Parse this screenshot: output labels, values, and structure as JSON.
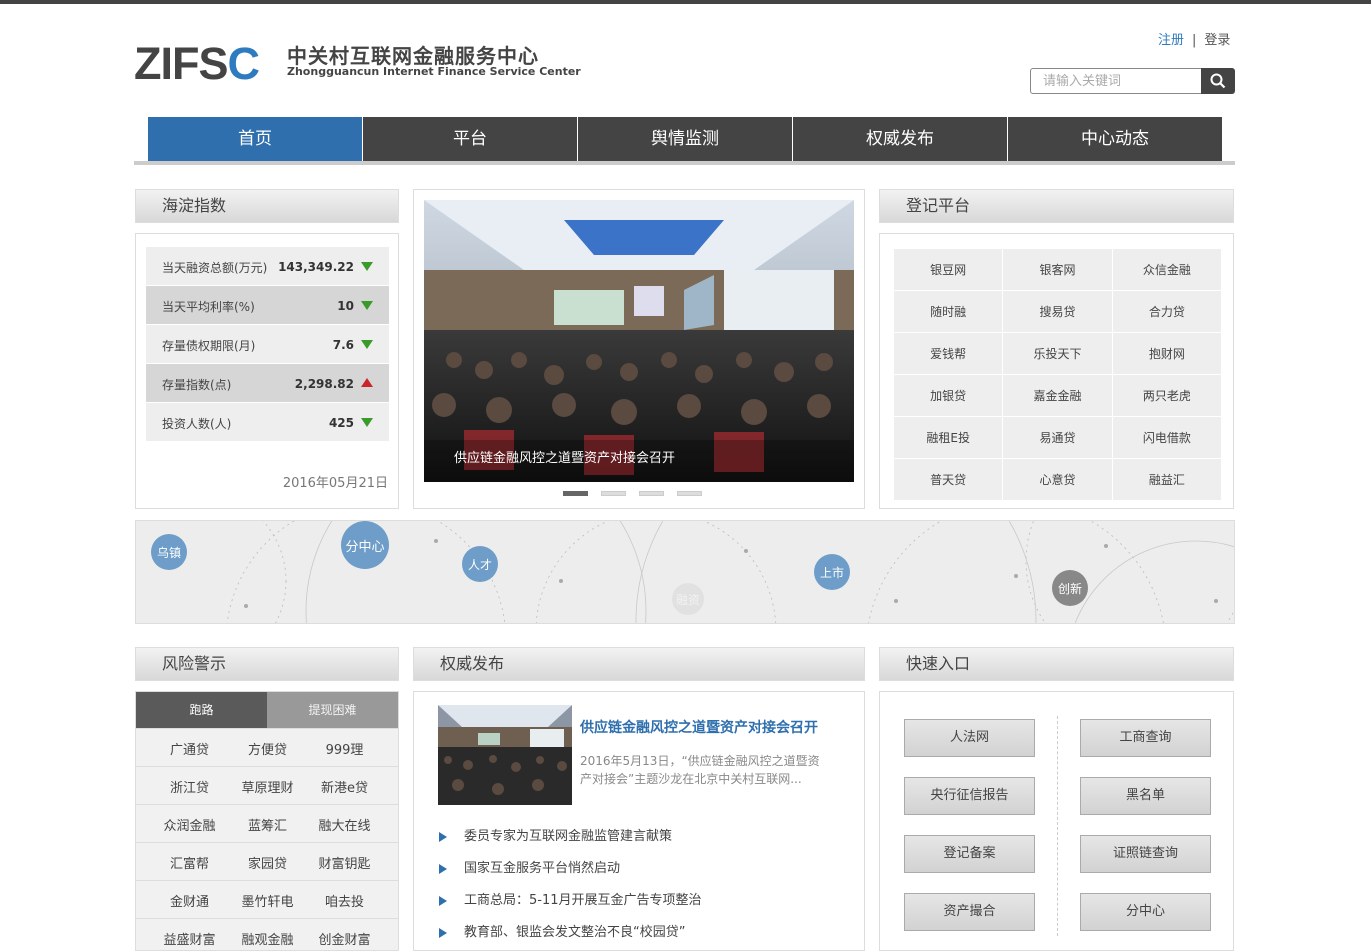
{
  "logo": {
    "mark": "ZIFS",
    "mark_c": "C",
    "name_cn": "中关村互联网金融服务中心",
    "name_en": "Zhongguancun Internet Finance Service Center"
  },
  "auth": {
    "register": "注册",
    "separator": "|",
    "login": "登录"
  },
  "search": {
    "placeholder": "请输入关键词",
    "icon": "search-icon"
  },
  "nav": {
    "items": [
      {
        "label": "首页",
        "active": true
      },
      {
        "label": "平台"
      },
      {
        "label": "舆情监测"
      },
      {
        "label": "权威发布"
      },
      {
        "label": "中心动态"
      }
    ]
  },
  "haidian": {
    "title": "海淀指数",
    "rows": [
      {
        "label": "当天融资总额(万元)",
        "value": "143,349.22",
        "trend": "down"
      },
      {
        "label": "当天平均利率(%)",
        "value": "10",
        "trend": "down"
      },
      {
        "label": "存量债权期限(月)",
        "value": "7.6",
        "trend": "down"
      },
      {
        "label": "存量指数(点)",
        "value": "2,298.82",
        "trend": "up"
      },
      {
        "label": "投资人数(人)",
        "value": "425",
        "trend": "down"
      }
    ],
    "date": "2016年05月21日"
  },
  "carousel": {
    "caption": "供应链金融风控之道暨资产对接会召开",
    "slide_count": 4,
    "active": 0
  },
  "registry": {
    "title": "登记平台",
    "items": [
      [
        "银豆网",
        "银客网",
        "众信金融"
      ],
      [
        "随时融",
        "搜易贷",
        "合力贷"
      ],
      [
        "爱钱帮",
        "乐投天下",
        "抱财网"
      ],
      [
        "加银贷",
        "嘉金金融",
        "两只老虎"
      ],
      [
        "融租E投",
        "易通贷",
        "闪电借款"
      ],
      [
        "普天贷",
        "心意贷",
        "融益汇"
      ]
    ]
  },
  "banner": {
    "bubbles": [
      "乌镇",
      "分中心",
      "人才",
      "上市",
      "创新",
      "融资"
    ]
  },
  "risk": {
    "title": "风险警示",
    "tabs": [
      "跑路",
      "提现困难"
    ],
    "rows": [
      [
        "广通贷",
        "方便贷",
        "999理"
      ],
      [
        "浙江贷",
        "草原理财",
        "新港e贷"
      ],
      [
        "众润金融",
        "蓝筹汇",
        "融大在线"
      ],
      [
        "汇富帮",
        "家园贷",
        "财富钥匙"
      ],
      [
        "金财通",
        "墨竹轩电",
        "咱去投"
      ],
      [
        "益盛财富",
        "融观金融",
        "创金财富"
      ]
    ]
  },
  "authority": {
    "title": "权威发布",
    "feature": {
      "title": "供应链金融风控之道暨资产对接会召开",
      "summary": "2016年5月13日，“供应链金融风控之道暨资产对接会”主题沙龙在北京中关村互联网..."
    },
    "list": [
      "委员专家为互联网金融监管建言献策",
      "国家互金服务平台悄然启动",
      "工商总局：5-11月开展互金广告专项整治",
      "教育部、银监会发文整治不良“校园贷”"
    ]
  },
  "quick": {
    "title": "快速入口",
    "left": [
      "人法网",
      "央行征信报告",
      "登记备案",
      "资产撮合"
    ],
    "right": [
      "工商查询",
      "黑名单",
      "证照链查询",
      "分中心"
    ]
  },
  "colors": {
    "nav_bg": "#444444",
    "nav_active": "#2f6fae",
    "accent": "#2f7bbf",
    "down": "#3a9a2a",
    "up": "#c8262a"
  }
}
